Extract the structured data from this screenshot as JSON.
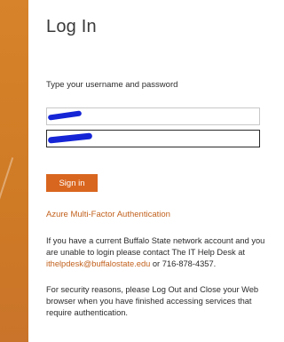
{
  "login": {
    "title": "Log In",
    "instruction": "Type your username and password",
    "username_value": "",
    "password_value": "",
    "signin_label": "Sign in",
    "mfa_link": "Azure Multi-Factor Authentication"
  },
  "help": {
    "paragraph1_before": "If you have a current Buffalo State network account and you are unable to login please contact The IT Help Desk at ",
    "email": "ithelpdesk@buffalostate.edu",
    "paragraph1_after": " or 716-878-4357.",
    "paragraph2": "For security reasons, please Log Out and Close your Web browser when you have finished accessing services that require authentication."
  },
  "colors": {
    "accent": "#d9661f",
    "link": "#c2611d",
    "side_bar": "#d6832b",
    "redaction": "#1525d6"
  }
}
